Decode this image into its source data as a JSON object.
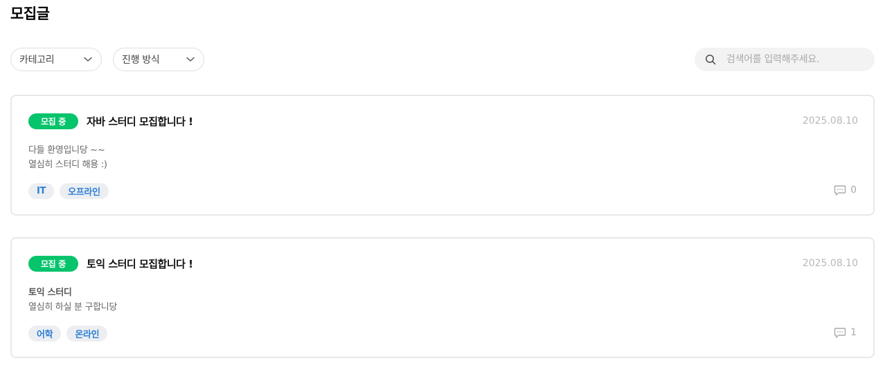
{
  "page": {
    "title": "모집글"
  },
  "filters": {
    "category": {
      "label": "카테고리",
      "icon": "chevron-down-icon"
    },
    "mode": {
      "label": "진행 방식",
      "icon": "chevron-down-icon"
    }
  },
  "search": {
    "placeholder": "검색어를 입력해주세요.",
    "value": "",
    "icon": "search-icon"
  },
  "colors": {
    "status_green": "#05c46b",
    "tag_blue": "#2d7fd6",
    "tag_bg": "#eceef1"
  },
  "posts": [
    {
      "status": "모집 중",
      "title": "자바 스터디 모집합니다 !",
      "date": "2025.08.10",
      "line1": "다들 환영입니당 ~~",
      "line2": "열심히 스터디 해용 :)",
      "tags": [
        "IT",
        "오프라인"
      ],
      "comment_count": "0"
    },
    {
      "status": "모집 중",
      "title": "토익 스터디 모집합니다 !",
      "date": "2025.08.10",
      "line1": "토익 스터디",
      "line2": "열심히 하실 분 구합니당",
      "tags": [
        "어학",
        "온라인"
      ],
      "comment_count": "1"
    }
  ]
}
